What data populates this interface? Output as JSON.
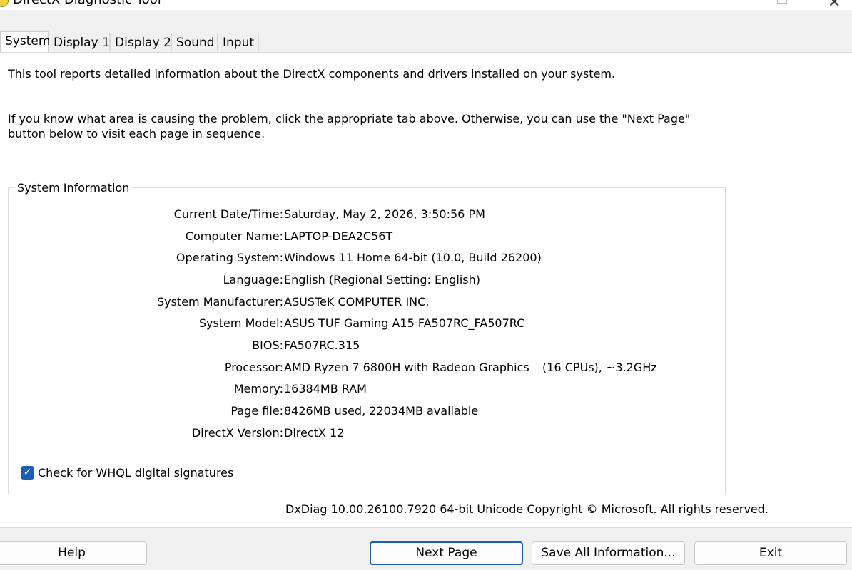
{
  "window": {
    "title": "DirectX Diagnostic Tool",
    "minimize_glyph": "—",
    "close_glyph": "✕"
  },
  "tabs": [
    {
      "label": "System",
      "active": true
    },
    {
      "label": "Display 1",
      "active": false
    },
    {
      "label": "Display 2",
      "active": false
    },
    {
      "label": "Sound",
      "active": false
    },
    {
      "label": "Input",
      "active": false
    }
  ],
  "intro": {
    "line1": "This tool reports detailed information about the DirectX components and drivers installed on your system.",
    "line2": "If you know what area is causing the problem, click the appropriate tab above.  Otherwise, you can use the \"Next Page\" button below to visit each page in sequence."
  },
  "system_info": {
    "title": "System Information",
    "rows": [
      {
        "label": "Current Date/Time:",
        "value": "Saturday, May 2, 2026, 3:50:56 PM"
      },
      {
        "label": "Computer Name:",
        "value": "LAPTOP-DEA2C56T"
      },
      {
        "label": "Operating System:",
        "value": "Windows 11 Home 64-bit (10.0, Build 26200)"
      },
      {
        "label": "Language:",
        "value": "English (Regional Setting: English)"
      },
      {
        "label": "System Manufacturer:",
        "value": "ASUSTeK COMPUTER INC."
      },
      {
        "label": "System Model:",
        "value": "ASUS TUF Gaming A15 FA507RC_FA507RC"
      },
      {
        "label": "BIOS:",
        "value": "FA507RC.315"
      },
      {
        "label": "Processor:",
        "value": "AMD Ryzen 7 6800H with Radeon Graphics",
        "value2": "(16 CPUs), ~3.2GHz"
      },
      {
        "label": "Memory:",
        "value": "16384MB RAM"
      },
      {
        "label": "Page file:",
        "value": "8426MB used, 22034MB available"
      },
      {
        "label": "DirectX Version:",
        "value": "DirectX 12"
      }
    ]
  },
  "whql": {
    "label": "Check for WHQL digital signatures",
    "checked": true,
    "check_glyph": "✓"
  },
  "footer": {
    "version_text": "DxDiag 10.00.26100.7920 64-bit Unicode  Copyright © Microsoft. All rights reserved."
  },
  "buttons": {
    "help": "Help",
    "next_page": "Next Page",
    "save_all": "Save All Information...",
    "exit": "Exit"
  },
  "colors": {
    "accent": "#1a5fb4"
  }
}
